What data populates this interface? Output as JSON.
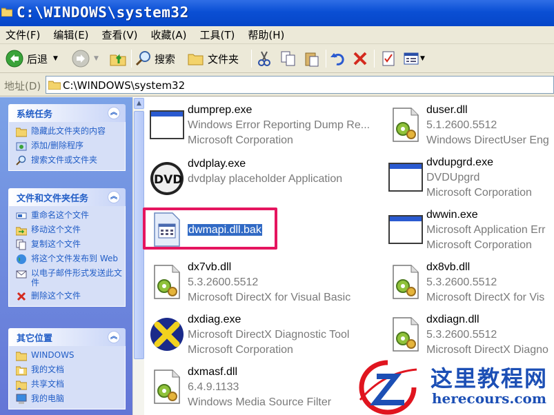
{
  "window": {
    "title": "C:\\WINDOWS\\system32"
  },
  "menu": [
    "文件(F)",
    "编辑(E)",
    "查看(V)",
    "收藏(A)",
    "工具(T)",
    "帮助(H)"
  ],
  "toolbar": {
    "back": "后退",
    "search": "搜索",
    "folders": "文件夹"
  },
  "address": {
    "label": "地址(D)",
    "value": "C:\\WINDOWS\\system32"
  },
  "tasks": {
    "system": {
      "title": "系统任务",
      "items": [
        "隐藏此文件夹的内容",
        "添加/删除程序",
        "搜索文件或文件夹"
      ]
    },
    "file": {
      "title": "文件和文件夹任务",
      "items": [
        "重命名这个文件",
        "移动这个文件",
        "复制这个文件",
        "将这个文件发布到 Web",
        "以电子邮件形式发送此文件",
        "删除这个文件"
      ]
    },
    "other": {
      "title": "其它位置",
      "items": [
        "WINDOWS",
        "我的文档",
        "共享文档",
        "我的电脑"
      ]
    }
  },
  "files": [
    {
      "name": "dumprep.exe",
      "line2": "Windows Error Reporting Dump Re...",
      "line3": "Microsoft Corporation",
      "icon": "exe-window-icon"
    },
    {
      "name": "duser.dll",
      "line2": "5.1.2600.5512",
      "line3": "Windows DirectUser Eng",
      "icon": "dll-gear-icon"
    },
    {
      "name": "dvdplay.exe",
      "line2": "dvdplay placeholder Application",
      "line3": "",
      "icon": "dvd-icon"
    },
    {
      "name": "dvdupgrd.exe",
      "line2": "DVDUpgrd",
      "line3": "Microsoft Corporation",
      "icon": "exe-window-icon"
    },
    {
      "name": "dwmapi.dll.bak",
      "line2": "",
      "line3": "",
      "icon": "unknown-file-icon"
    },
    {
      "name": "dwwin.exe",
      "line2": "Microsoft Application Err",
      "line3": "Microsoft Corporation",
      "icon": "exe-window-icon"
    },
    {
      "name": "dx7vb.dll",
      "line2": "5.3.2600.5512",
      "line3": "Microsoft DirectX for Visual Basic",
      "icon": "dll-gear-icon"
    },
    {
      "name": "dx8vb.dll",
      "line2": "5.3.2600.5512",
      "line3": "Microsoft DirectX for Vis",
      "icon": "dll-gear-icon"
    },
    {
      "name": "dxdiag.exe",
      "line2": "Microsoft DirectX Diagnostic Tool",
      "line3": "Microsoft Corporation",
      "icon": "directx-icon"
    },
    {
      "name": "dxdiagn.dll",
      "line2": "5.3.2600.5512",
      "line3": "Microsoft DirectX Diagno",
      "icon": "dll-gear-icon"
    },
    {
      "name": "dxmasf.dll",
      "line2": "6.4.9.1133",
      "line3": "Windows Media Source Filter",
      "icon": "dll-gear-icon"
    }
  ],
  "watermark": {
    "cn": "这里教程网",
    "en": "herecours.com"
  }
}
